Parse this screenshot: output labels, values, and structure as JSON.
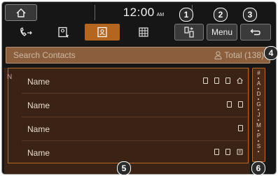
{
  "status": {
    "time": "12:00",
    "ampm": "AM",
    "home_icon": "home-icon"
  },
  "tabs": [
    {
      "icon": "call-history-icon",
      "active": false
    },
    {
      "icon": "favorites-icon",
      "active": false
    },
    {
      "icon": "contacts-icon",
      "active": true
    },
    {
      "icon": "dial-pad-icon",
      "active": false
    }
  ],
  "toolbar": {
    "switch_icon": "phone-switch-icon",
    "menu_label": "Menu",
    "back_icon": "back-icon"
  },
  "search": {
    "placeholder": "Search Contacts",
    "total_label": "Total (138)",
    "total_icon": "person-icon"
  },
  "list": {
    "section_letter": "N",
    "rows": [
      {
        "name": "Name",
        "icons": [
          "phone-square-icon",
          "phone-square-icon",
          "phone-square-icon",
          "home-icon"
        ]
      },
      {
        "name": "Name",
        "icons": [
          "phone-square-icon",
          "phone-square-icon"
        ]
      },
      {
        "name": "Name",
        "icons": [
          "phone-square-icon"
        ]
      },
      {
        "name": "Name",
        "icons": [
          "phone-square-icon",
          "phone-square-icon",
          "office-icon"
        ]
      }
    ]
  },
  "index": [
    "#",
    "A",
    "D",
    "G",
    "J",
    "M",
    "P",
    "S"
  ],
  "callouts": [
    "1",
    "2",
    "3",
    "4",
    "5",
    "6"
  ],
  "colors": {
    "accent": "#b4651f",
    "list_bg": "#3a2315",
    "search_bg": "#8b5f3e",
    "screen_bg": "#161616"
  }
}
